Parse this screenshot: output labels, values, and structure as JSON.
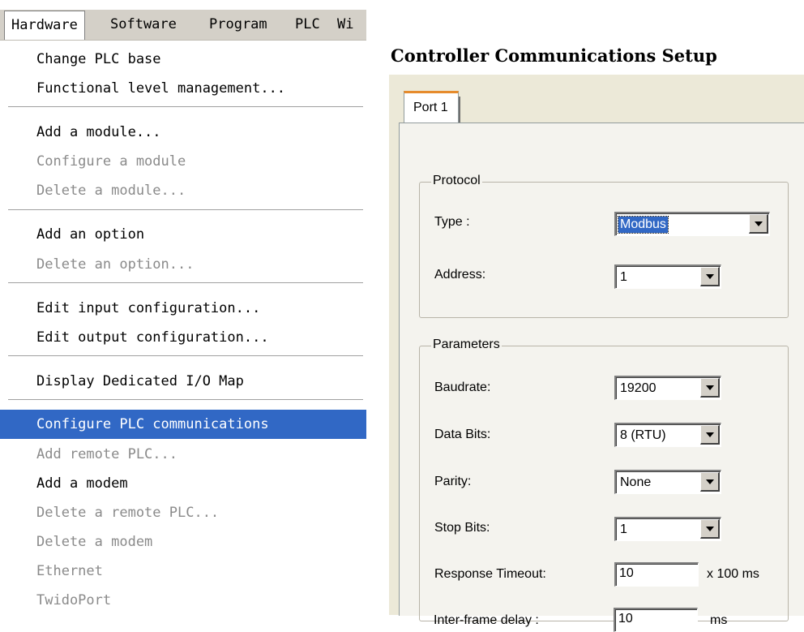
{
  "menubar": {
    "items": [
      "Hardware",
      "Software",
      "Program",
      "PLC",
      "Wi"
    ]
  },
  "menu": {
    "items": [
      {
        "label": "Change PLC base",
        "state": "enabled"
      },
      {
        "label": "Functional level management...",
        "state": "enabled"
      },
      {
        "label": "Add a module...",
        "state": "enabled"
      },
      {
        "label": "Configure a module",
        "state": "disabled"
      },
      {
        "label": "Delete a module...",
        "state": "disabled"
      },
      {
        "label": "Add an option",
        "state": "enabled"
      },
      {
        "label": "Delete an option...",
        "state": "disabled"
      },
      {
        "label": "Edit input configuration...",
        "state": "enabled"
      },
      {
        "label": "Edit output configuration...",
        "state": "enabled"
      },
      {
        "label": "Display Dedicated I/O Map",
        "state": "enabled"
      },
      {
        "label": "Configure PLC communications",
        "state": "highlighted"
      },
      {
        "label": "Add remote PLC...",
        "state": "disabled"
      },
      {
        "label": "Add a modem",
        "state": "enabled"
      },
      {
        "label": "Delete a remote PLC...",
        "state": "disabled"
      },
      {
        "label": "Delete a modem",
        "state": "disabled"
      },
      {
        "label": "Ethernet",
        "state": "disabled"
      },
      {
        "label": "TwidoPort",
        "state": "disabled"
      }
    ]
  },
  "dialog": {
    "title": "Controller Communications Setup",
    "tab": "Port 1",
    "protocol": {
      "group_label": "Protocol",
      "type_label": "Type :",
      "type_value": "Modbus",
      "address_label": "Address:",
      "address_value": "1"
    },
    "parameters": {
      "group_label": "Parameters",
      "baudrate_label": "Baudrate:",
      "baudrate_value": "19200",
      "databits_label": "Data Bits:",
      "databits_value": "8 (RTU)",
      "parity_label": "Parity:",
      "parity_value": "None",
      "stopbits_label": "Stop Bits:",
      "stopbits_value": "1",
      "timeout_label": "Response Timeout:",
      "timeout_value": "10",
      "timeout_unit": "x 100 ms",
      "interframe_label": "Inter-frame delay :",
      "interframe_value": "10",
      "interframe_unit": "ms"
    }
  },
  "colors": {
    "highlight": "#3168c5",
    "disabled_text": "#8a8a8a",
    "dialog_bg": "#ece9d8"
  }
}
